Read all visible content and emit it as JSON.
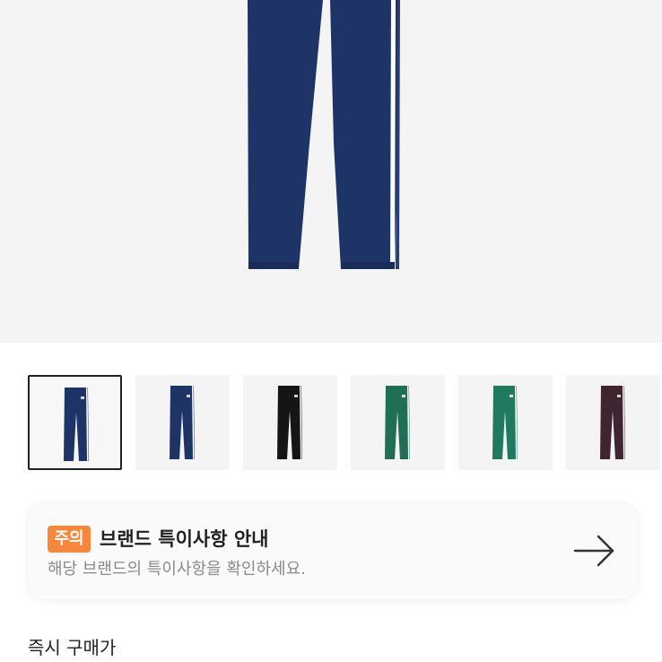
{
  "hero": {
    "image": "pants-navy-main",
    "background": "#f4f4f4"
  },
  "thumbnails": [
    {
      "color": "#1f3466",
      "stripe": "#ffffff",
      "selected": true
    },
    {
      "color": "#1f3466",
      "stripe": "#ffffff",
      "selected": false
    },
    {
      "color": "#151515",
      "stripe": "#ffffff",
      "selected": false
    },
    {
      "color": "#1f6e55",
      "stripe": "#ffffff",
      "selected": false
    },
    {
      "color": "#1f7a5e",
      "stripe": "#ffffff",
      "selected": false
    },
    {
      "color": "#3e2530",
      "stripe": "#ffffff",
      "selected": false
    }
  ],
  "notice": {
    "badge": "주의",
    "title": "브랜드 특이사항 안내",
    "description": "해당 브랜드의 특이사항을 확인하세요.",
    "icon": "arrow-right-icon",
    "badge_color": "#f7873a"
  },
  "section": {
    "title": "즉시 구매가"
  }
}
